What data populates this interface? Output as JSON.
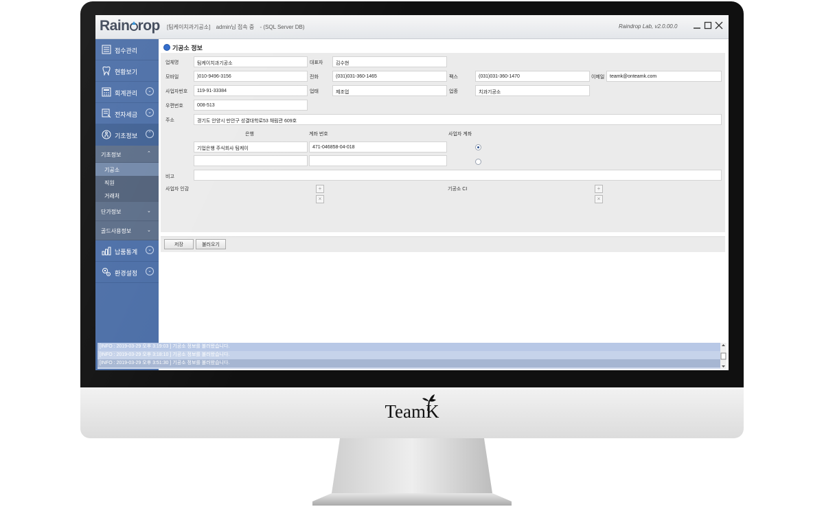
{
  "app": {
    "logo_pre": "Rain",
    "logo_post": "rop",
    "lab_name": "[팀케이치과기공소]",
    "session": "admin님 접속 중",
    "db_info": "- (SQL Server DB)",
    "version": "Raindrop Lab, v2.0.00.0"
  },
  "sidebar": {
    "items": [
      {
        "label": "접수관리",
        "icon": "list-icon"
      },
      {
        "label": "현황보기",
        "icon": "tooth-icon"
      },
      {
        "label": "회계관리",
        "icon": "calculator-icon"
      },
      {
        "label": "전자세금",
        "icon": "invoice-icon"
      },
      {
        "label": "기초정보",
        "icon": "info-icon"
      }
    ],
    "sub_header": "기초정보",
    "sub_items": [
      "기공소",
      "직원",
      "거래처"
    ],
    "collapsed": [
      "단가정보",
      "골드사용정보"
    ],
    "bottom_items": [
      {
        "label": "납품통계",
        "icon": "bar-chart-icon"
      },
      {
        "label": "환경설정",
        "icon": "settings-icon"
      }
    ]
  },
  "section": {
    "title": "기공소 정보"
  },
  "form": {
    "company_label": "업체명",
    "company": "팀케이치과기공소",
    "ceo_label": "대표자",
    "ceo": "김수현",
    "mobile_label": "모바일",
    "mobile": ")010-9496-3156",
    "phone_label": "전화",
    "phone": "(031)031-360-1465",
    "fax_label": "팩스",
    "fax": "(031)031-360-1470",
    "email_label": "이메일",
    "email": "teamk@onteamk.com",
    "bizno_label": "사업자번호",
    "bizno": "119-91-33384",
    "biztype_label": "업태",
    "biztype": "제조업",
    "bizitem_label": "업종",
    "bizitem": "치과기공소",
    "zip_label": "우편번호",
    "zip": "008-513",
    "addr_label": "주소",
    "addr": "경기도 안양시 만안구 성결대학로53 채림관 609호",
    "bank_col": "은행",
    "acct_col": "계좌 번호",
    "bizacct_col": "사업자 계좌",
    "bank1": "기업은행 주식회사 팀케이",
    "acct1": "471-046858-04-018",
    "memo_label": "비고",
    "seal_label": "사업자 인감",
    "ci_label": "기공소 CI"
  },
  "buttons": {
    "save": "저장",
    "load": "불러오기"
  },
  "log": [
    "[INFO : 2019-03-29 오후 3:19:03 ] 기공소 정보를 불러왔습니다.",
    "[INFO : 2019-03-29 오후 3:18:10 ] 기공소 정보를 불러왔습니다.",
    "[INFO : 2019-03-29 오후 3:51:30 ] 기공소 정보를 불러왔습니다."
  ],
  "monitor_brand": "TeamK",
  "colors": {
    "sidebar": "#4a6da6",
    "sidebar_sub": "#4f5f78",
    "accent": "#2b67c9"
  }
}
